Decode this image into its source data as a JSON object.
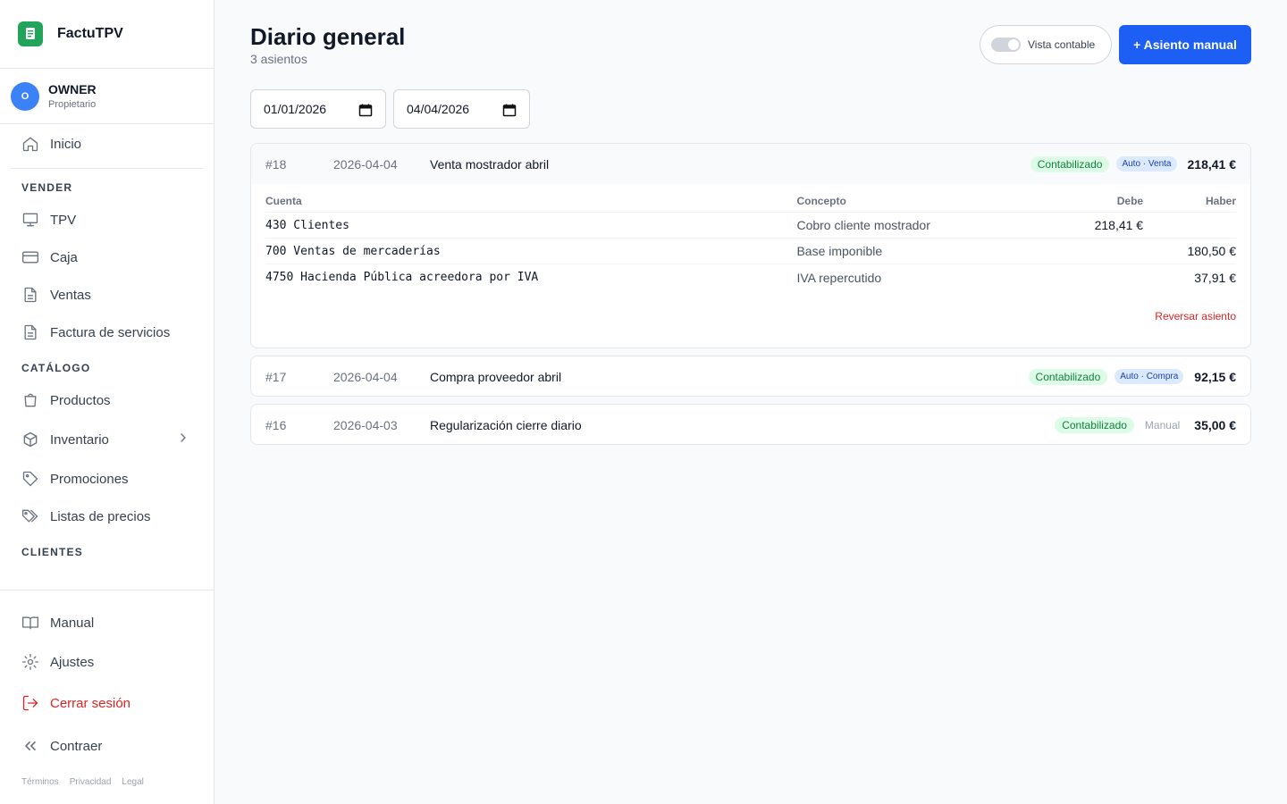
{
  "app": {
    "name": "FactuTPV"
  },
  "user": {
    "initial": "O",
    "name": "OWNER",
    "role": "Propietario"
  },
  "sidebar": {
    "home": "Inicio",
    "section_sell": "VENDER",
    "sell_items": [
      "TPV",
      "Caja",
      "Ventas",
      "Factura de servicios"
    ],
    "section_catalog": "CATÁLOGO",
    "catalog_items": [
      "Productos",
      "Inventario",
      "Promociones",
      "Listas de precios"
    ],
    "section_clients": "CLIENTES",
    "bottom_items": [
      "Manual",
      "Ajustes",
      "Cerrar sesión",
      "Contraer"
    ],
    "legal": [
      "Términos",
      "Privacidad",
      "Legal"
    ]
  },
  "page": {
    "title": "Diario general",
    "subtitle": "3 asientos",
    "toggle_label": "Vista contable",
    "toggle_on": false,
    "new_entry_button": "+ Asiento manual",
    "date_from": "01/01/2026",
    "date_to": "04/04/2026"
  },
  "table_headers": {
    "account": "Cuenta",
    "concept": "Concepto",
    "debit": "Debe",
    "credit": "Haber"
  },
  "entries": [
    {
      "number": "#18",
      "date": "2026-04-04",
      "description": "Venta mostrador abril",
      "status": "Contabilizado",
      "source": "Auto · Venta",
      "amount": "218,41 €",
      "lines": [
        {
          "account": "430 Clientes",
          "concept": "Cobro cliente mostrador",
          "debit": "218,41 €",
          "credit": ""
        },
        {
          "account": "700 Ventas de mercaderías",
          "concept": "Base imponible",
          "debit": "",
          "credit": "180,50 €"
        },
        {
          "account": "4750 Hacienda Pública acreedora por IVA",
          "concept": "IVA repercutido",
          "debit": "",
          "credit": "37,91 €"
        }
      ],
      "reverse_label": "Reversar asiento"
    },
    {
      "number": "#17",
      "date": "2026-04-04",
      "description": "Compra proveedor abril",
      "status": "Contabilizado",
      "source": "Auto · Compra",
      "amount": "92,15 €"
    },
    {
      "number": "#16",
      "date": "2026-04-03",
      "description": "Regularización cierre diario",
      "status": "Contabilizado",
      "source": "Manual",
      "amount": "35,00 €"
    }
  ],
  "colors": {
    "primary": "#1d5ff5",
    "brand": "#22a55a",
    "success_bg": "#dcfce7",
    "success_text": "#15803d",
    "danger": "#dc2626"
  }
}
